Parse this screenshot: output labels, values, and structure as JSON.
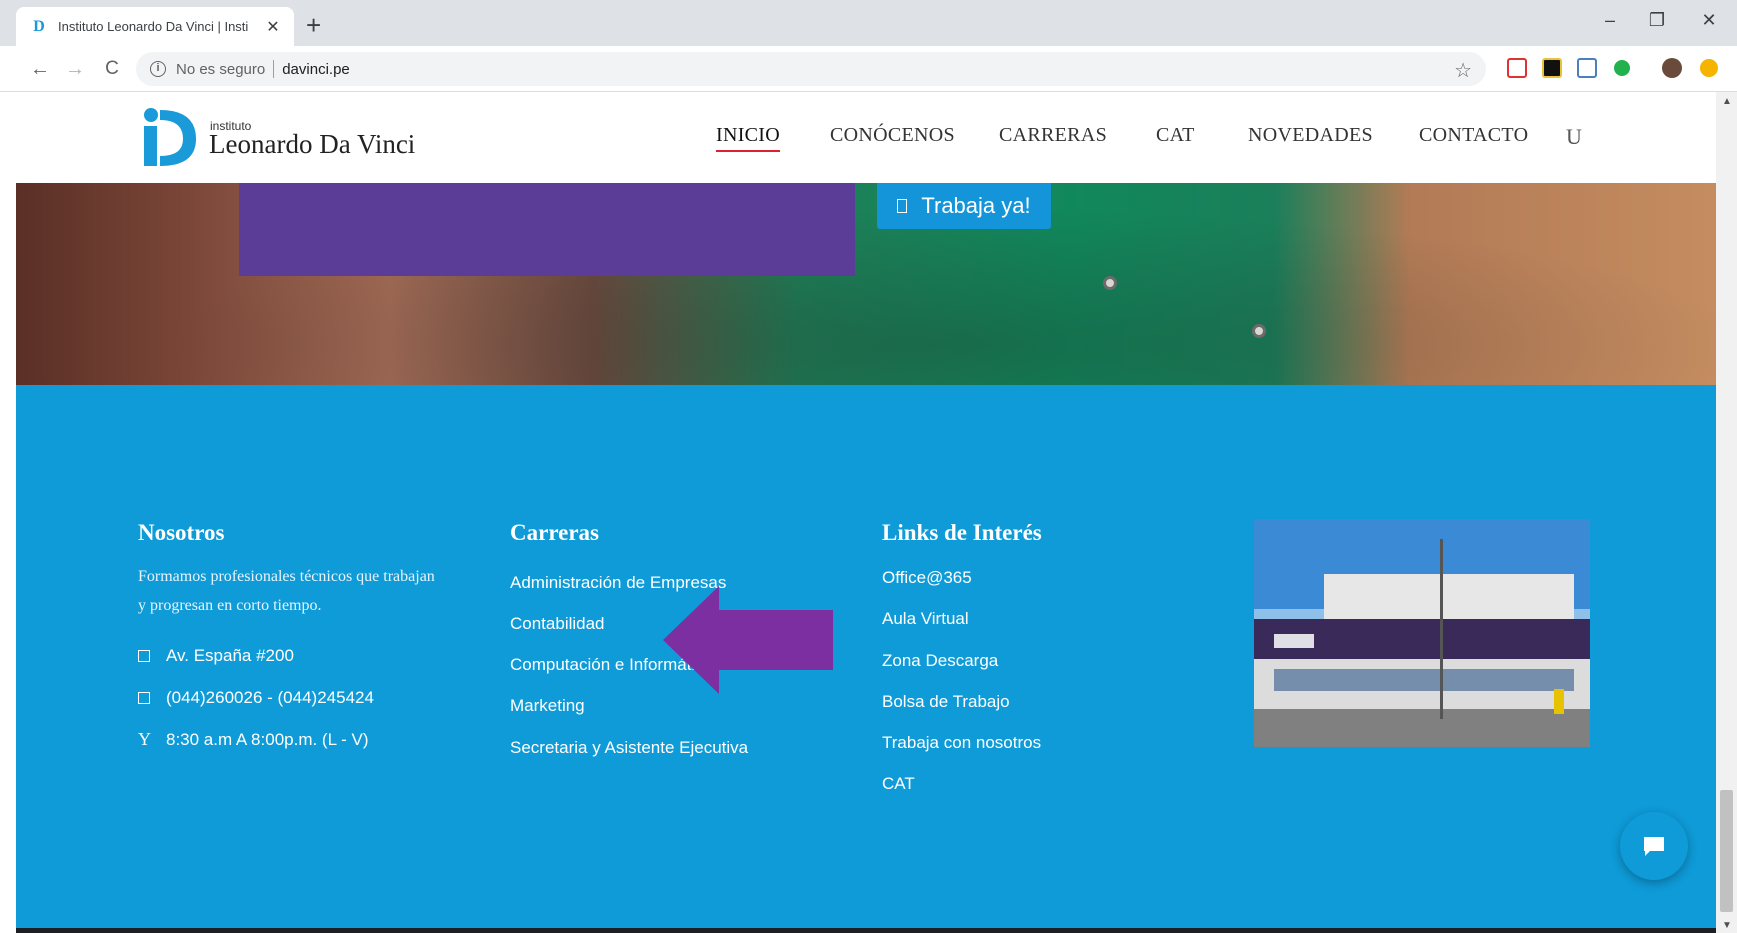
{
  "browser": {
    "tab_title": "Instituto Leonardo Da Vinci | Insti",
    "tab_favicon": "D",
    "tab_close": "✕",
    "new_tab": "+",
    "minimize": "–",
    "restore": "❐",
    "close": "✕",
    "back": "←",
    "forward": "→",
    "reload": "C",
    "security_label": "No es seguro",
    "url": "davinci.pe",
    "bookmark": "☆"
  },
  "site": {
    "logo_small": "instituto",
    "logo_name": "Leonardo Da Vinci",
    "nav": [
      {
        "label": "INICIO"
      },
      {
        "label": "CONÓCENOS"
      },
      {
        "label": "CARRERAS"
      },
      {
        "label": "CAT"
      },
      {
        "label": "NOVEDADES"
      },
      {
        "label": "CONTACTO"
      },
      {
        "label": "U"
      }
    ]
  },
  "hero": {
    "button_label": "Trabaja ya!"
  },
  "footer": {
    "nosotros": {
      "title": "Nosotros",
      "text": "Formamos profesionales técnicos que trabajan y progresan en corto tiempo.",
      "address": "Av. España #200",
      "phone": "(044)260026 - (044)245424",
      "hours_icon": "Y",
      "hours": "8:30 a.m A 8:00p.m. (L - V)"
    },
    "carreras": {
      "title": "Carreras",
      "items": [
        "Administración de Empresas",
        "Contabilidad",
        "Computación e Informática",
        "Marketing",
        "Secretaria y Asistente Ejecutiva"
      ]
    },
    "links": {
      "title": "Links de Interés",
      "items": [
        "Office@365",
        "Aula Virtual",
        "Zona Descarga",
        "Bolsa de Trabajo",
        "Trabaja con nosotros",
        "CAT"
      ]
    }
  },
  "colors": {
    "footer_blue": "#0e9bd8",
    "hero_purple": "#5b3d98",
    "arrow_purple": "#7b2fa0",
    "nav_active_underline": "#d9242b"
  }
}
